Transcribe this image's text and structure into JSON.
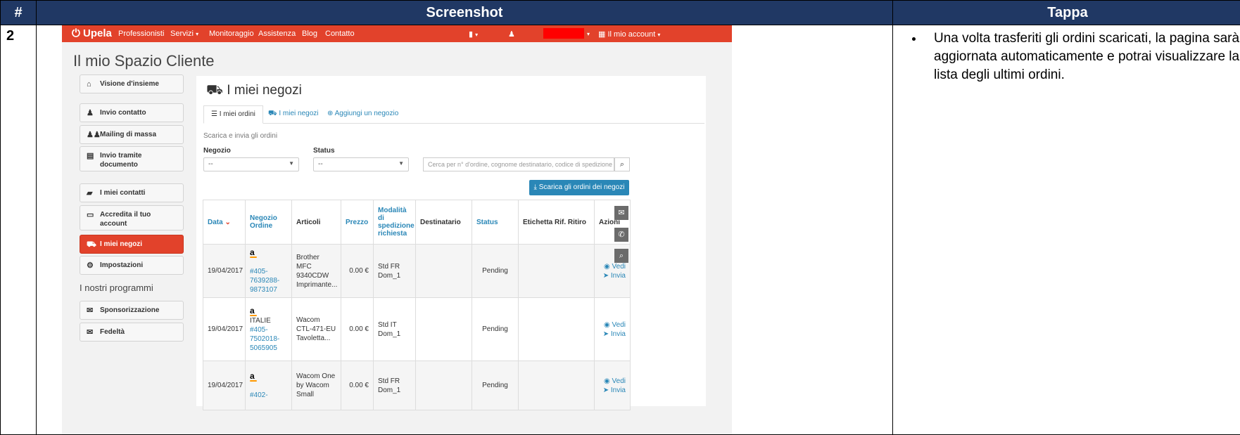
{
  "doc": {
    "col_number": "#",
    "col_screenshot": "Screenshot",
    "col_step": "Tappa",
    "row_number": "2",
    "step_text": "Una volta trasferiti gli ordini scaricati, la pagina sarà aggiornata automaticamente e potrai visualizzare la lista degli ultimi ordini."
  },
  "nav": {
    "brand": "Upela",
    "items": [
      "Professionisti",
      "Servizi",
      "Monitoraggio",
      "Assistenza",
      "Blog",
      "Contatto"
    ],
    "account_label": "Il mio account"
  },
  "page_title": "Il mio Spazio Cliente",
  "sidebar": {
    "items": [
      {
        "label": "Visione d'insieme",
        "icon": "home-icon"
      },
      {
        "label": "Invio contatto",
        "icon": "user-icon"
      },
      {
        "label": "Mailing di massa",
        "icon": "users-icon"
      },
      {
        "label": "Invio tramite documento",
        "icon": "file-icon"
      },
      {
        "label": "I miei contatti",
        "icon": "book-icon"
      },
      {
        "label": "Accredita il tuo account",
        "icon": "card-icon"
      },
      {
        "label": "I miei negozi",
        "icon": "cart-icon"
      },
      {
        "label": "Impostazioni",
        "icon": "gear-icon"
      }
    ],
    "programs_heading": "I nostri programmi",
    "programs": [
      {
        "label": "Sponsorizzazione",
        "icon": "gift-icon"
      },
      {
        "label": "Fedeltà",
        "icon": "gift-icon"
      }
    ]
  },
  "main": {
    "title": "I miei negozi",
    "tabs": [
      "I miei ordini",
      "I miei negozi",
      "Aggiungi un negozio"
    ],
    "subtitle": "Scarica e invia gli ordini",
    "filter_shop_label": "Negozio",
    "filter_shop_value": "--",
    "filter_status_label": "Status",
    "filter_status_value": "--",
    "search_placeholder": "Cerca per n° d'ordine, cognome destinatario, codice di spedizione o n° di",
    "download_button": "Scarica gli ordini dei negozi",
    "table": {
      "headers": [
        "Data",
        "Negozio Ordine",
        "Articoli",
        "Prezzo",
        "Modalità di spedizione richiesta",
        "Destinatario",
        "Status",
        "Etichetta Rif. Ritiro",
        "Azioni"
      ],
      "rows": [
        {
          "date": "19/04/2017",
          "shop": "a",
          "shop_extra": "",
          "order": "#405-7639288-9873107",
          "article": "Brother MFC 9340CDW Imprimante...",
          "price": "0.00 €",
          "shipping": "Std FR Dom_1",
          "recipient": "",
          "status": "Pending",
          "label": "",
          "action_view": "Vedi",
          "action_send": "Invia"
        },
        {
          "date": "19/04/2017",
          "shop": "a",
          "shop_extra": "ITALIE",
          "order": "#405-7502018-5065905",
          "article": "Wacom CTL-471-EU Tavoletta...",
          "price": "0.00 €",
          "shipping": "Std IT Dom_1",
          "recipient": "",
          "status": "Pending",
          "label": "",
          "action_view": "Vedi",
          "action_send": "Invia"
        },
        {
          "date": "19/04/2017",
          "shop": "a",
          "shop_extra": "",
          "order": "#402-",
          "article": "Wacom One by Wacom Small",
          "price": "0.00 €",
          "shipping": "Std FR Dom_1",
          "recipient": "",
          "status": "Pending",
          "label": "",
          "action_view": "Vedi",
          "action_send": "Invia"
        }
      ]
    }
  },
  "float_icons": [
    "envelope-icon",
    "phone-icon",
    "search-icon"
  ]
}
